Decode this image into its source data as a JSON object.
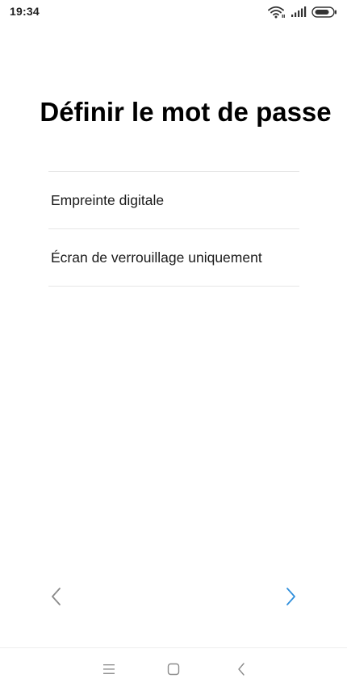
{
  "status_bar": {
    "time": "19:34",
    "icons": [
      "wifi-icon",
      "signal-icon",
      "battery-icon"
    ]
  },
  "page": {
    "title": "Définir le mot de passe"
  },
  "options": [
    {
      "label": "Empreinte digitale",
      "icon": ""
    },
    {
      "label": "Écran de verrouillage uniquement",
      "icon": ""
    }
  ],
  "navigation": {
    "prev_icon": "chevron-left-icon",
    "next_icon": "chevron-right-icon",
    "prev_color": "#8a8a8a",
    "next_color": "#2f8fdc"
  },
  "system_nav": {
    "icons": [
      "menu-icon",
      "home-icon",
      "back-icon"
    ],
    "color": "#8a8a8a"
  }
}
